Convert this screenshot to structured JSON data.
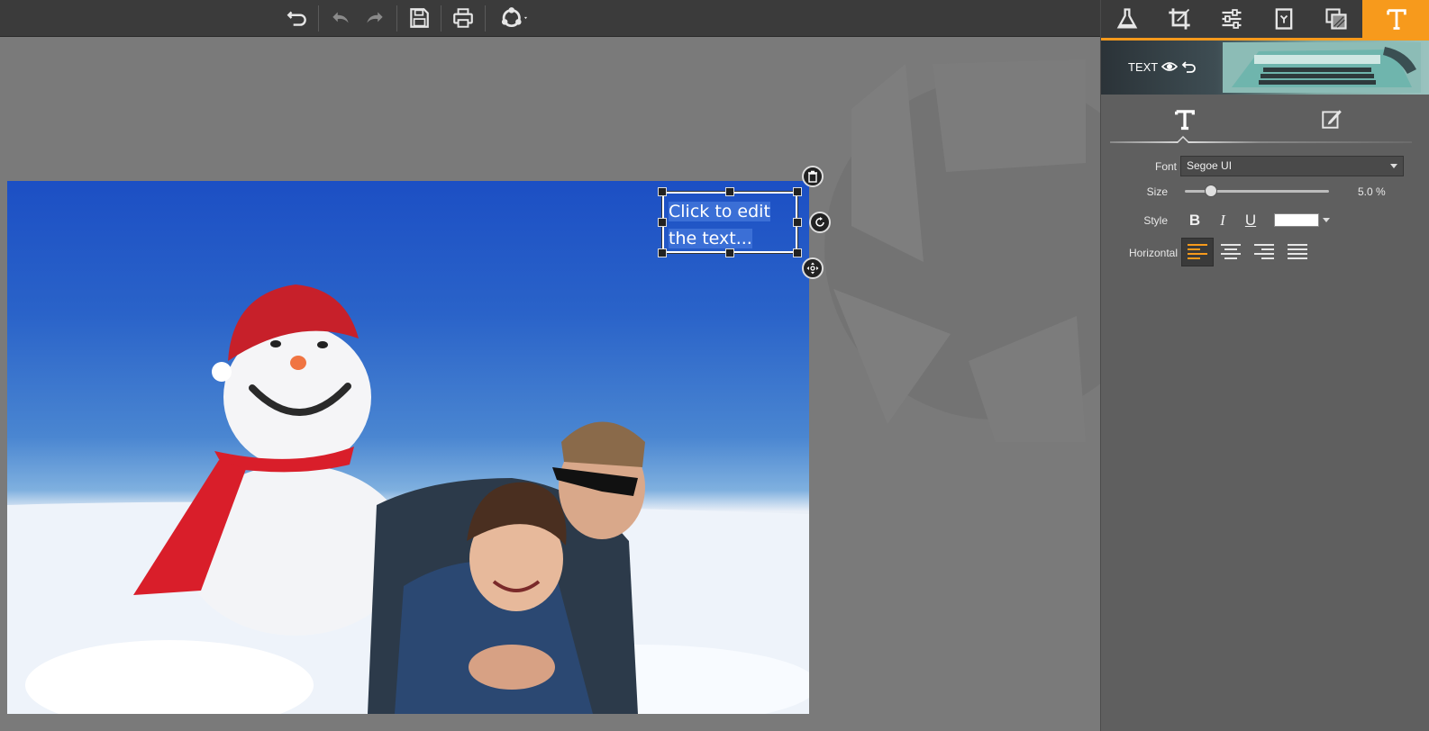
{
  "toolbar": {
    "buttons": [
      {
        "name": "undo-all-button",
        "icon": "undo-arrow-icon"
      },
      {
        "name": "undo-button",
        "icon": "undo-icon"
      },
      {
        "name": "redo-button",
        "icon": "redo-icon"
      },
      {
        "name": "save-button",
        "icon": "floppy-disk-icon"
      },
      {
        "name": "print-button",
        "icon": "printer-icon"
      },
      {
        "name": "share-button",
        "icon": "share-circle-icon"
      }
    ]
  },
  "textbox": {
    "line1": "Click to edit",
    "line2": "the text..."
  },
  "panel": {
    "tabs": [
      "flask-icon",
      "crop-icon",
      "sliders-icon",
      "frame-icon",
      "layers-icon",
      "text-icon"
    ],
    "active_tab": "text-icon",
    "banner_label": "TEXT",
    "font_label": "Font",
    "font_value": "Segoe UI",
    "size_label": "Size",
    "size_value": "5.0 %",
    "size_fraction": 0.18,
    "style_label": "Style",
    "bold": "B",
    "italic": "I",
    "underline": "U",
    "text_color": "#ffffff",
    "horizontal_label": "Horizontal",
    "alignments": [
      "align-left",
      "align-center",
      "align-right",
      "align-justify"
    ],
    "active_alignment": "align-left"
  },
  "colors": {
    "accent": "#f79a1c",
    "toolbar_bg": "#3b3b3b",
    "panel_bg": "#5f5f5f",
    "canvas_bg": "#7a7a7a"
  }
}
